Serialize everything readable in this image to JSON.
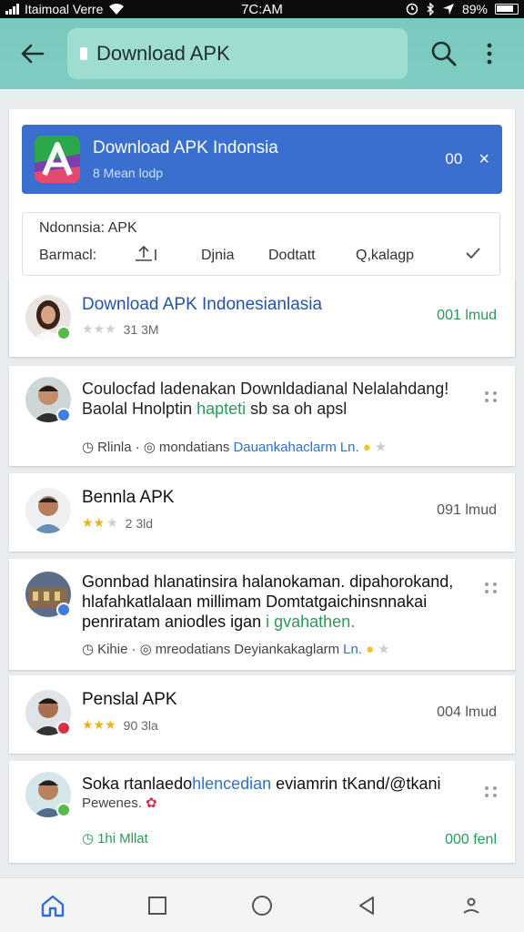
{
  "status_bar": {
    "carrier": "Itaimoal Verre",
    "time": "7C:AM",
    "battery": "89%"
  },
  "app_bar": {
    "search_text": "Download APK"
  },
  "banner": {
    "title": "Download APK Indonsia",
    "subtitle": "8 Mean lodp",
    "count": "00",
    "close": "×"
  },
  "filter": {
    "label": "Ndonnsia: APK",
    "items": [
      "Barmacl:",
      "Djnia",
      "Dodtatt",
      "Q,kalagp"
    ]
  },
  "items": [
    {
      "title": "Download APK Indonesianlasia",
      "meta": "31 3M",
      "size": "001 lmud",
      "stars": 0
    },
    {
      "text_line1": "Coulocfad ladenakan Downldadianal Nelalahdang!",
      "text_line2a": "Baolal Hnolptin ",
      "text_line2b": "hapteti",
      "text_line2c": " sb sa oh apsl",
      "footer_a": "Rlinla ·",
      "footer_b": "mondatians",
      "footer_c": "Dauankahaclarm",
      "footer_d": "Ln."
    },
    {
      "title": "Bennla APK",
      "meta": "2 3ld",
      "size": "091 lmud",
      "stars": 2
    },
    {
      "text_line1": "Gonnbad hlanatinsira halanokaman. dipahorokand,",
      "text_line2": "hlafahkatlalaan millimam Domtatgaichinsnnakai",
      "text_line3a": "penriratam aniodles igan ",
      "text_line3b": "i gvahathen.",
      "footer_a": "Kihie ·",
      "footer_b": "mreodatians",
      "footer_c": "Deyiankakaglarm",
      "footer_d": "Ln."
    },
    {
      "title": "Penslal APK",
      "meta": "90 3la",
      "size": "004 lmud",
      "stars": 3
    },
    {
      "text_line1a": "Soka rtanlaedo",
      "text_line1b": "hlencedian",
      "text_line1c": " eviamrin tKand/@tkani",
      "text_line2": "Pewenes.",
      "footer_a": "1hi",
      "footer_b": "Mllat",
      "size": "000 fenl"
    }
  ]
}
